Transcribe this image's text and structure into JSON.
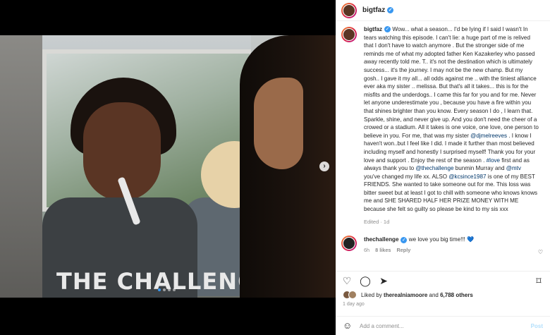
{
  "media": {
    "shirt_text": "THE CHALLENGE",
    "next_icon": "›",
    "carousel_dots": 4,
    "active_dot": 0
  },
  "post": {
    "username": "bigtfaz",
    "verified_mark": "✓"
  },
  "caption": {
    "username": "bigtfaz",
    "verified_mark": "✓",
    "text_part1": "Wow... what a season... I'd be lying if I said I wasn't In tears watching this episode. I can't lie: a huge part of me is relived that I don't have to watch anymore . But the stronger side of me reminds me of what my adopted father Ken Kazakerley who passed away recently told me. T.. it's not the destination which is ultimately success... it's the journey. I may not be the new champ. But my gosh.. I gave it my all... all odds against me .. with the tiniest alliance ever aka my sister .. melissa. But that's all it takes... this is for the misfits and the underdogs.. I came this far for you and for me. Never let anyone underestimate you , because you have a fire within you that shines brighter than you know. Every season I do , I learn that. Sparkle, shine, and never give up. And you don't need the cheer of a crowed or a stadium. All it takes is one voice, one love, one person to believe in you. For me, that was my sister ",
    "mention1": "@djmelreeves",
    "text_part2": " . I know I haven't won..but I feel like I did. I made it further than most believed including myself and honestly I surprised myself! Thank you for your love and support . Enjoy the rest of the season . ",
    "tag1": "#love",
    "text_part3": " first and as always thank you to ",
    "mention2": "@thechallenge",
    "text_part4": " bunmin Murray and ",
    "mention3": "@mtv",
    "text_part5": " you've changed my life xx. ALSO ",
    "mention4": "@kcsince1987",
    "text_part6": " is one of my BEST FRIENDS. She wanted to take someone out for me. This loss was bitter sweet but at least I got to chill with someone who knows knows me and SHE SHARED HALF HER PRIZE MONEY WITH ME because she felt so guilty so please be kind to my sis xxx",
    "meta": "Edited · 1d"
  },
  "comment": {
    "username": "thechallenge",
    "verified_mark": "✓",
    "text": "we love you big time!!! ",
    "heart": "💙",
    "time": "6h",
    "likes": "8 likes",
    "reply": "Reply"
  },
  "actions": {
    "like_icon": "♡",
    "comment_icon": "◯",
    "share_icon": "➤",
    "save_icon": "⌑"
  },
  "likes": {
    "prefix": "Liked by ",
    "user": "therealniamoore",
    "middle": " and ",
    "count": "6,788 others"
  },
  "time_ago": "1 day ago",
  "add_comment": {
    "emoji_icon": "☺",
    "placeholder": "Add a comment...",
    "post_label": "Post"
  }
}
